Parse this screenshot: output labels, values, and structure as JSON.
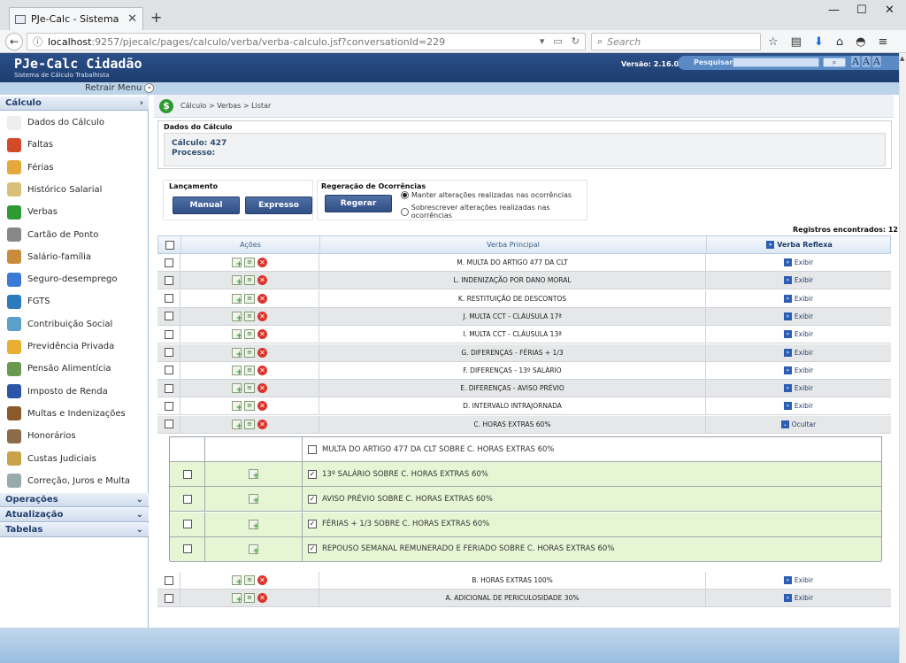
{
  "browser": {
    "tab_title": "PJe-Calc - Sistema de Cálculo",
    "url_host": "localhost",
    "url_path": ":9257/pjecalc/pages/calculo/verba/verba-calculo.jsf?conversationId=229",
    "search_placeholder": "Search"
  },
  "app": {
    "brand": "PJe-Calc Cidadão",
    "brand_sub": "Sistema de Cálculo Trabalhista",
    "version": "Versão: 2.16.0",
    "search_label": "Pesquisar",
    "font_buttons": [
      "A",
      "A",
      "A"
    ],
    "retrair": "Retrair Menu"
  },
  "sidebar": {
    "calculo_label": "Cálculo",
    "items": [
      {
        "label": "Dados do Cálculo",
        "icon": "document-icon"
      },
      {
        "label": "Faltas",
        "icon": "calendar-faltas-icon"
      },
      {
        "label": "Férias",
        "icon": "calendar-ferias-icon"
      },
      {
        "label": "Histórico Salarial",
        "icon": "money-notes-icon"
      },
      {
        "label": "Verbas",
        "icon": "dollar-icon"
      },
      {
        "label": "Cartão de Ponto",
        "icon": "clock-icon"
      },
      {
        "label": "Salário-família",
        "icon": "family-icon"
      },
      {
        "label": "Seguro-desemprego",
        "icon": "person-icon"
      },
      {
        "label": "FGTS",
        "icon": "fgts-icon"
      },
      {
        "label": "Contribuição Social",
        "icon": "coins-icon"
      },
      {
        "label": "Previdência Privada",
        "icon": "piggy-icon"
      },
      {
        "label": "Pensão Alimentícia",
        "icon": "cash-icon"
      },
      {
        "label": "Imposto de Renda",
        "icon": "lion-icon"
      },
      {
        "label": "Multas e Indenizações",
        "icon": "gavel-icon"
      },
      {
        "label": "Honorários",
        "icon": "lawyer-icon"
      },
      {
        "label": "Custas Judiciais",
        "icon": "scales-icon"
      },
      {
        "label": "Correção, Juros e Multa",
        "icon": "calculator-icon"
      }
    ],
    "sections": [
      "Operações",
      "Atualização",
      "Tabelas"
    ]
  },
  "main": {
    "breadcrumb": "Cálculo > Verbas > Listar",
    "dados_title": "Dados do Cálculo",
    "calculo": "Cálculo: 427",
    "processo": "Processo:",
    "lancamento_title": "Lançamento",
    "btn_manual": "Manual",
    "btn_expresso": "Expresso",
    "regeracao_title": "Regeração de Ocorrências",
    "btn_regerar": "Regerar",
    "radio_manter": "Manter alterações realizadas nas ocorrências",
    "radio_sobrescrever": "Sobrescrever alterações realizadas nas ocorrências",
    "registros": "Registros encontrados: 12",
    "col_acoes": "Ações",
    "col_verba": "Verba Principal",
    "col_reflexa": "Verba Reflexa",
    "exibir": "Exibir",
    "ocultar": "Ocultar",
    "rows": [
      "M. MULTA DO ARTIGO 477 DA CLT",
      "L. INDENIZAÇÃO POR DANO MORAL",
      "K. RESTITUIÇÃO DE DESCONTOS",
      "J. MULTA CCT - CLÁUSULA 17ª",
      "I. MULTA CCT - CLÁUSULA 13ª",
      "G. DIFERENÇAS - FÉRIAS + 1/3",
      "F. DIFERENÇAS - 13º SALÁRIO",
      "E. DIFERENÇAS - AVISO PRÉVIO",
      "D. INTERVALO INTRAJORNADA",
      "C. HORAS EXTRAS 60%"
    ],
    "reflexas": [
      {
        "label": "MULTA DO ARTIGO 477 DA CLT SOBRE C. HORAS EXTRAS 60%",
        "checked": false
      },
      {
        "label": "13º SALÁRIO SOBRE C. HORAS EXTRAS 60%",
        "checked": true
      },
      {
        "label": "AVISO PRÉVIO SOBRE C. HORAS EXTRAS 60%",
        "checked": true
      },
      {
        "label": "FÉRIAS + 1/3 SOBRE C. HORAS EXTRAS 60%",
        "checked": true
      },
      {
        "label": "REPOUSO SEMANAL REMUNERADO E FERIADO SOBRE C. HORAS EXTRAS 60%",
        "checked": true
      }
    ],
    "rows_after": [
      "B. HORAS EXTRAS 100%",
      "A. ADICIONAL DE PERICULOSIDADE 30%"
    ]
  }
}
